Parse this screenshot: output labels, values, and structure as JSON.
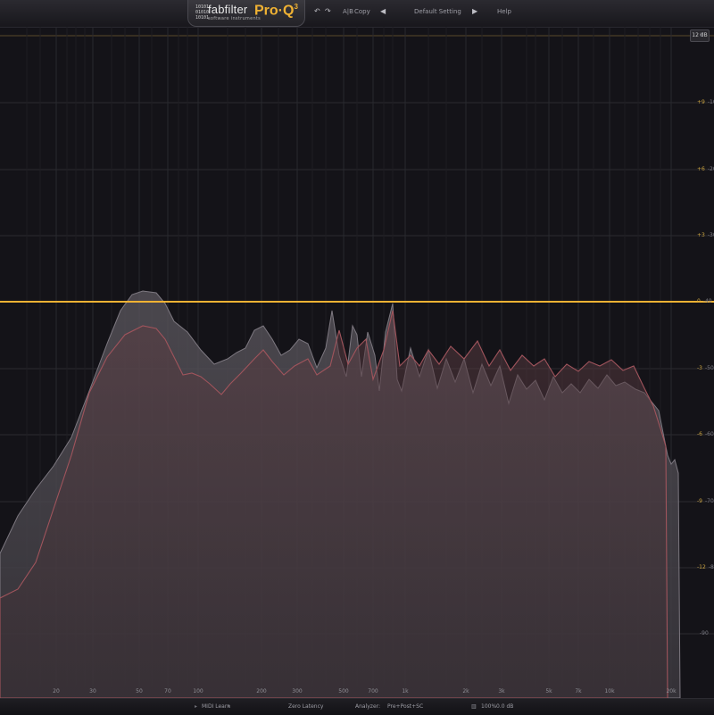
{
  "header": {
    "logo_grid": "10101\n01010\n10101",
    "logo_text": "fabfilter",
    "logo_subtext": "software instruments",
    "product": "Pro·Q",
    "product_version": "3",
    "undo_label": "↶",
    "redo_label": "↷",
    "ab_label": "A|B",
    "copy_label": "Copy",
    "preset_prev": "◀",
    "preset_name": "Default Setting",
    "preset_next": "▶",
    "help_label": "Help"
  },
  "display": {
    "range_badge": "12 dB",
    "gain_labels": [
      {
        "eq": "",
        "spec": "0"
      },
      {
        "eq": "+9",
        "spec": "-10"
      },
      {
        "eq": "+6",
        "spec": "-20"
      },
      {
        "eq": "+3",
        "spec": "-30"
      },
      {
        "eq": "0",
        "spec": "-40"
      },
      {
        "eq": "-3",
        "spec": "-50"
      },
      {
        "eq": "-6",
        "spec": "-60"
      },
      {
        "eq": "-9",
        "spec": "-70"
      },
      {
        "eq": "-12",
        "spec": "-80"
      },
      {
        "eq": "",
        "spec": "-90"
      }
    ],
    "freq_labels": [
      "20",
      "30",
      "50",
      "70",
      "100",
      "200",
      "300",
      "500",
      "700",
      "1k",
      "2k",
      "3k",
      "5k",
      "7k",
      "10k",
      "20k"
    ]
  },
  "footer": {
    "midi_learn": "MIDI Learn",
    "latency": "Zero Latency",
    "analyzer_label": "Analyzer:",
    "analyzer_value": "Pre+Post+SC",
    "zoom": "100%",
    "output_gain": "0.0 dB"
  },
  "colors": {
    "accent": "#f0b233",
    "background": "#141318",
    "pre_spectrum": "#8a858c",
    "post_spectrum": "#a0545c"
  }
}
